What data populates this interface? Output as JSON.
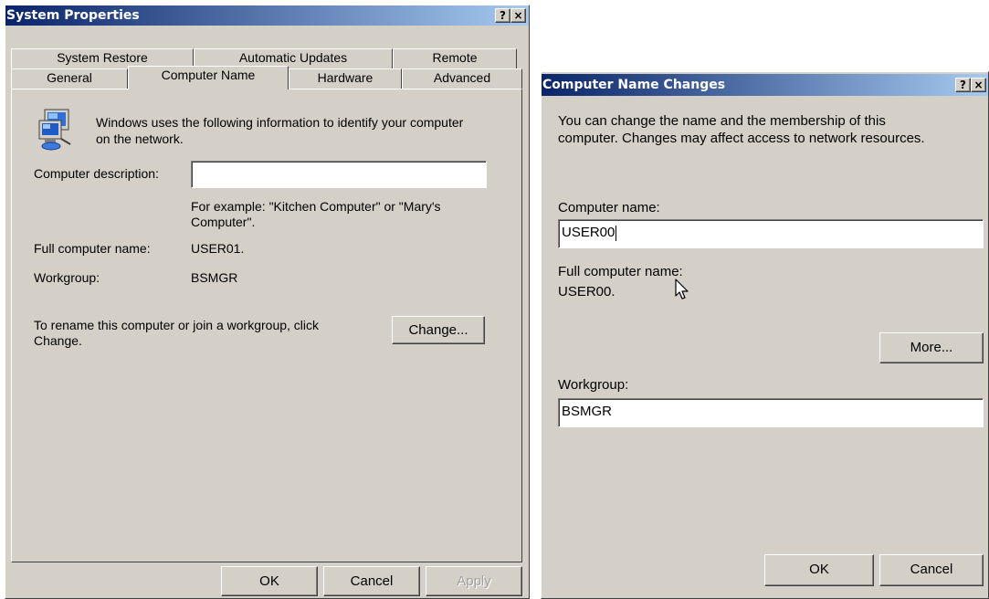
{
  "system_properties": {
    "title": "System Properties",
    "help_glyph": "?",
    "close_glyph": "×",
    "tabs_row1": [
      "System Restore",
      "Automatic Updates",
      "Remote"
    ],
    "tabs_row2": [
      "General",
      "Computer Name",
      "Hardware",
      "Advanced"
    ],
    "active_tab": "Computer Name",
    "intro_text_line1": "Windows uses the following information to identify your computer",
    "intro_text_line2": "on the network.",
    "description_label": "Computer description:",
    "description_value": "",
    "example_line1": "For example: \"Kitchen Computer\" or \"Mary's",
    "example_line2": "Computer\".",
    "full_name_label": "Full computer name:",
    "full_name_value": "USER01.",
    "workgroup_label": "Workgroup:",
    "workgroup_value": "BSMGR",
    "rename_text_line1": "To rename this computer or join a workgroup, click",
    "rename_text_line2": "Change.",
    "change_button": "Change...",
    "ok_button": "OK",
    "cancel_button": "Cancel",
    "apply_button": "Apply",
    "icon": "computer-network-icon"
  },
  "name_changes": {
    "title": "Computer Name Changes",
    "help_glyph": "?",
    "close_glyph": "×",
    "intro_line1": "You can change the name and the membership of this",
    "intro_line2": "computer. Changes may affect access to network resources.",
    "computer_name_label": "Computer name:",
    "computer_name_value": "USER00",
    "full_name_label": "Full computer name:",
    "full_name_value": "USER00.",
    "more_button": "More...",
    "workgroup_label": "Workgroup:",
    "workgroup_value": "BSMGR",
    "ok_button": "OK",
    "cancel_button": "Cancel"
  },
  "colors": {
    "title_gradient_start": "#0a246a",
    "title_gradient_end": "#a6caf0",
    "dialog_face": "#d4d0c8"
  }
}
